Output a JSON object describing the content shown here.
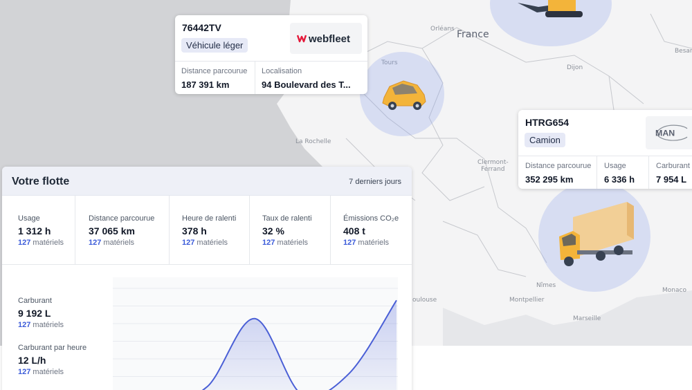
{
  "map": {
    "labels": [
      {
        "key": "orleans",
        "text": "Orléans"
      },
      {
        "key": "france",
        "text": "France"
      },
      {
        "key": "tours",
        "text": "Tours"
      },
      {
        "key": "dijon",
        "text": "Dijon"
      },
      {
        "key": "besancon",
        "text": "Besançon"
      },
      {
        "key": "la_rochelle",
        "text": "La Rochelle"
      },
      {
        "key": "clermont",
        "text": "Clermont-\nFerrand"
      },
      {
        "key": "nimes",
        "text": "Nîmes"
      },
      {
        "key": "montpellier",
        "text": "Montpellier"
      },
      {
        "key": "toulouse",
        "text": "oulouse"
      },
      {
        "key": "marseille",
        "text": "Marseille"
      },
      {
        "key": "monaco",
        "text": "Monaco"
      }
    ]
  },
  "vehicles": [
    {
      "plate": "76442TV",
      "type": "Véhicule léger",
      "brand_logo": "webfleet",
      "icon": "car-icon",
      "stats": [
        {
          "label": "Distance parcourue",
          "value": "187 391 km"
        },
        {
          "label": "Localisation",
          "value": "94 Boulevard des T..."
        }
      ]
    },
    {
      "plate": "HTRG654",
      "type": "Camion",
      "brand_logo": "MAN",
      "icon": "truck-icon",
      "stats": [
        {
          "label": "Distance parcourue",
          "value": "352 295 km"
        },
        {
          "label": "Usage",
          "value": "6 336 h"
        },
        {
          "label": "Carburant",
          "value": "7 954 L"
        }
      ]
    },
    {
      "icon": "excavator-icon"
    }
  ],
  "fleet": {
    "title": "Votre flotte",
    "period": "7 derniers jours",
    "stats": [
      {
        "label": "Usage",
        "value": "1 312 h",
        "count": "127",
        "unit": " matériels"
      },
      {
        "label": "Distance parcourue",
        "value": "37 065 km",
        "count": "127",
        "unit": " matériels"
      },
      {
        "label": "Heure de ralenti",
        "value": "378 h",
        "count": "127",
        "unit": " matériels"
      },
      {
        "label": "Taux de ralenti",
        "value": "32 %",
        "count": "127",
        "unit": " matériels"
      },
      {
        "label": "Émissions CO₂e",
        "value": "408 t",
        "count": "127",
        "unit": " matériels"
      }
    ],
    "fuel": [
      {
        "label": "Carburant",
        "value": "9 192 L",
        "count": "127",
        "unit": " matériels"
      },
      {
        "label": "Carburant par heure",
        "value": "12 L/h",
        "count": "127",
        "unit": " matériels"
      }
    ]
  },
  "colors": {
    "accent": "#3b5bd9",
    "halo": "#8ca0eb",
    "line": "#4a5fd6",
    "vehicle": "#f3b43a"
  },
  "chart_data": {
    "type": "line",
    "title": "",
    "xlabel": "",
    "ylabel": "",
    "x": [
      0,
      1,
      2,
      3,
      4,
      5,
      6
    ],
    "series": [
      {
        "values": [
          0.02,
          0.0,
          0.15,
          0.82,
          0.07,
          0.28,
          1.0
        ]
      }
    ],
    "grid": true,
    "ylim": [
      0,
      1.05
    ]
  }
}
